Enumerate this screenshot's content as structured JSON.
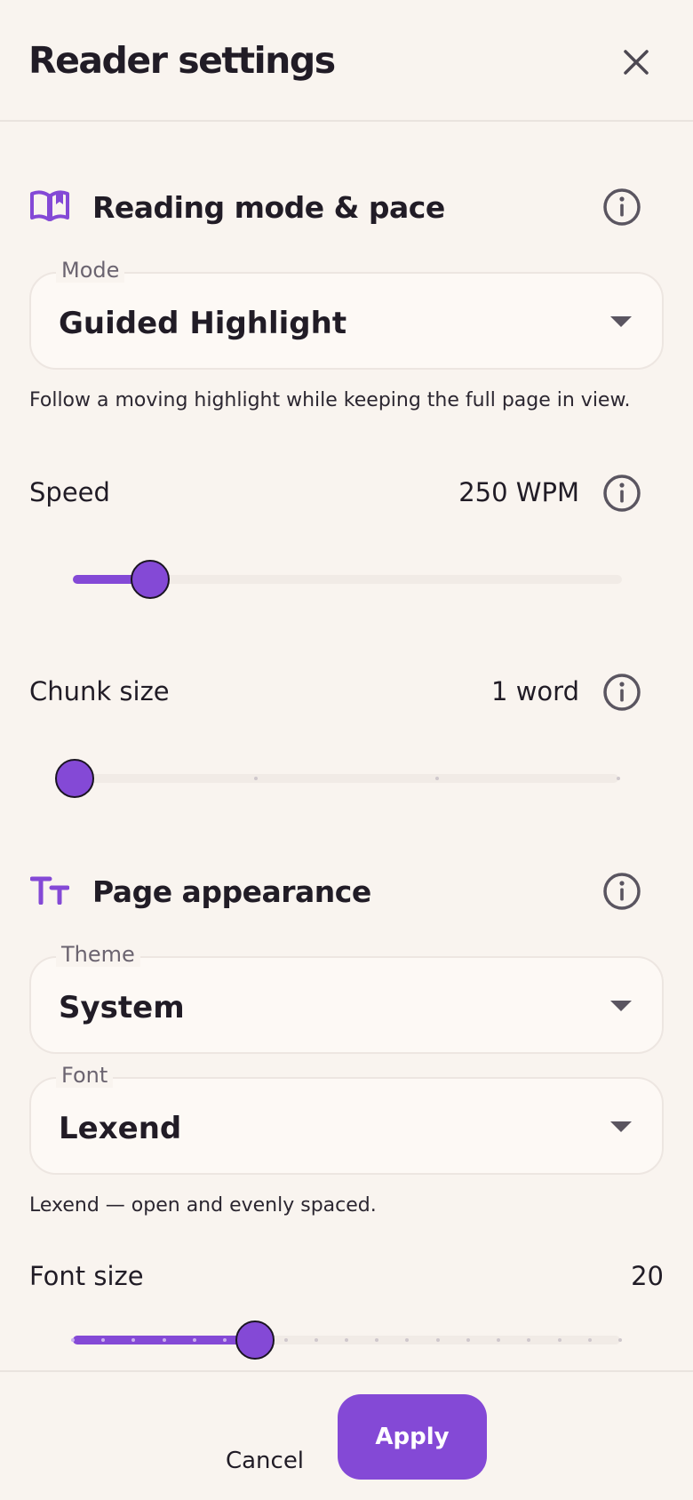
{
  "header": {
    "title": "Reader settings"
  },
  "reading": {
    "title": "Reading mode & pace",
    "mode": {
      "label": "Mode",
      "value": "Guided Highlight"
    },
    "mode_helper": "Follow a moving highlight while keeping the full page in view.",
    "speed": {
      "label": "Speed",
      "value": "250 WPM",
      "fraction": 0.14
    },
    "chunk": {
      "label": "Chunk size",
      "value": "1 word",
      "steps": 4,
      "selected_index": 0
    }
  },
  "appearance": {
    "title": "Page appearance",
    "theme": {
      "label": "Theme",
      "value": "System"
    },
    "font": {
      "label": "Font",
      "value": "Lexend"
    },
    "font_helper": "Lexend — open and evenly spaced.",
    "font_size": {
      "label": "Font size",
      "value": "20",
      "steps": 19,
      "selected_index": 6
    }
  },
  "footer": {
    "cancel_label": "Cancel",
    "apply_label": "Apply"
  },
  "colors": {
    "accent": "#8449d6",
    "background": "#f9f4ef",
    "text": "#211c26",
    "muted": "#6b6470"
  },
  "icons": {
    "close": "close-icon",
    "reading_mode": "open-book-icon",
    "appearance": "text-size-icon",
    "info": "info-icon",
    "dropdown": "caret-down-icon"
  }
}
